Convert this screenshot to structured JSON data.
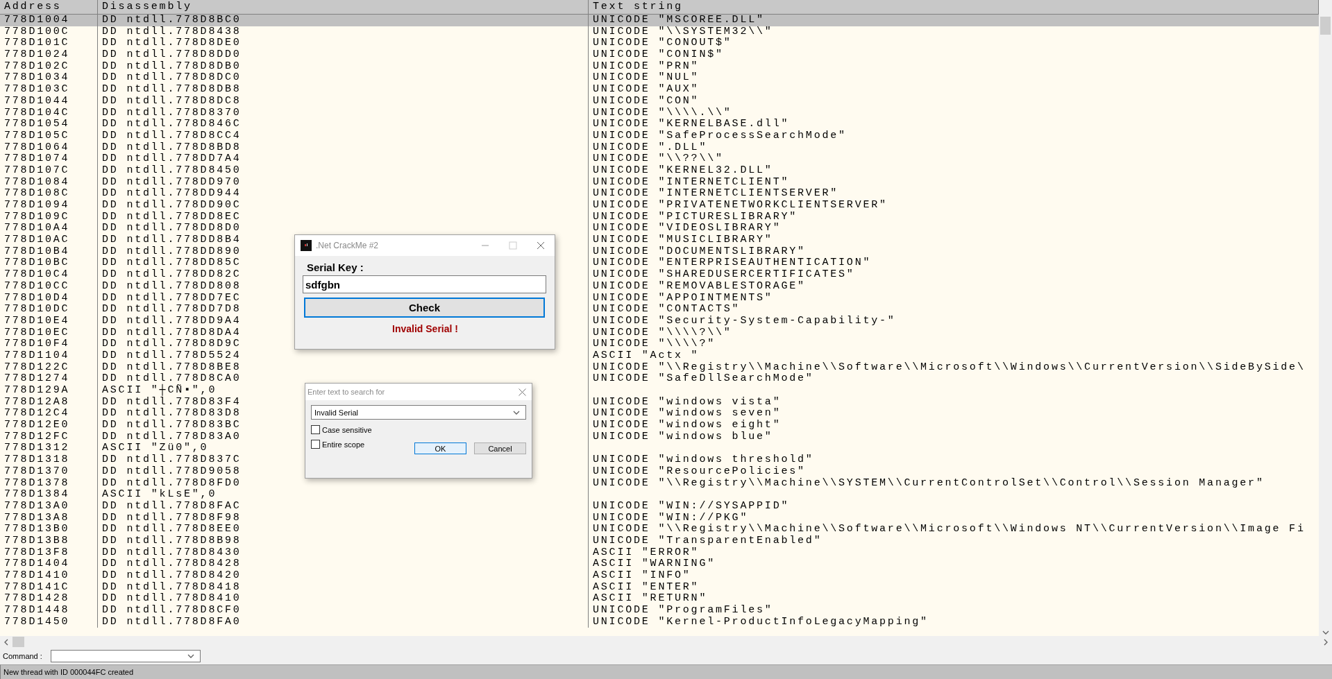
{
  "table": {
    "columns": [
      "Address",
      "Disassembly",
      "Text string"
    ],
    "rows": [
      {
        "address": "778D1004",
        "disassembly": "DD ntdll.778D8BC0",
        "text": "UNICODE \"MSCOREE.DLL\"",
        "selected": true
      },
      {
        "address": "778D100C",
        "disassembly": "DD ntdll.778D8438",
        "text": "UNICODE \"\\\\SYSTEM32\\\\\"",
        "selected": false
      },
      {
        "address": "778D101C",
        "disassembly": "DD ntdll.778D8DE0",
        "text": "UNICODE \"CONOUT$\"",
        "selected": false
      },
      {
        "address": "778D1024",
        "disassembly": "DD ntdll.778D8DD0",
        "text": "UNICODE \"CONIN$\"",
        "selected": false
      },
      {
        "address": "778D102C",
        "disassembly": "DD ntdll.778D8DB0",
        "text": "UNICODE \"PRN\"",
        "selected": false
      },
      {
        "address": "778D1034",
        "disassembly": "DD ntdll.778D8DC0",
        "text": "UNICODE \"NUL\"",
        "selected": false
      },
      {
        "address": "778D103C",
        "disassembly": "DD ntdll.778D8DB8",
        "text": "UNICODE \"AUX\"",
        "selected": false
      },
      {
        "address": "778D1044",
        "disassembly": "DD ntdll.778D8DC8",
        "text": "UNICODE \"CON\"",
        "selected": false
      },
      {
        "address": "778D104C",
        "disassembly": "DD ntdll.778D8370",
        "text": "UNICODE \"\\\\\\\\.\\\\\"",
        "selected": false
      },
      {
        "address": "778D1054",
        "disassembly": "DD ntdll.778D846C",
        "text": "UNICODE \"KERNELBASE.dll\"",
        "selected": false
      },
      {
        "address": "778D105C",
        "disassembly": "DD ntdll.778D8CC4",
        "text": "UNICODE \"SafeProcessSearchMode\"",
        "selected": false
      },
      {
        "address": "778D1064",
        "disassembly": "DD ntdll.778D8BD8",
        "text": "UNICODE \".DLL\"",
        "selected": false
      },
      {
        "address": "778D1074",
        "disassembly": "DD ntdll.778DD7A4",
        "text": "UNICODE \"\\\\??\\\\\"",
        "selected": false
      },
      {
        "address": "778D107C",
        "disassembly": "DD ntdll.778D8450",
        "text": "UNICODE \"KERNEL32.DLL\"",
        "selected": false
      },
      {
        "address": "778D1084",
        "disassembly": "DD ntdll.778DD970",
        "text": "UNICODE \"INTERNETCLIENT\"",
        "selected": false
      },
      {
        "address": "778D108C",
        "disassembly": "DD ntdll.778DD944",
        "text": "UNICODE \"INTERNETCLIENTSERVER\"",
        "selected": false
      },
      {
        "address": "778D1094",
        "disassembly": "DD ntdll.778DD90C",
        "text": "UNICODE \"PRIVATENETWORKCLIENTSERVER\"",
        "selected": false
      },
      {
        "address": "778D109C",
        "disassembly": "DD ntdll.778DD8EC",
        "text": "UNICODE \"PICTURESLIBRARY\"",
        "selected": false
      },
      {
        "address": "778D10A4",
        "disassembly": "DD ntdll.778DD8D0",
        "text": "UNICODE \"VIDEOSLIBRARY\"",
        "selected": false
      },
      {
        "address": "778D10AC",
        "disassembly": "DD ntdll.778DD8B4",
        "text": "UNICODE \"MUSICLIBRARY\"",
        "selected": false
      },
      {
        "address": "778D10B4",
        "disassembly": "DD ntdll.778DD890",
        "text": "UNICODE \"DOCUMENTSLIBRARY\"",
        "selected": false
      },
      {
        "address": "778D10BC",
        "disassembly": "DD ntdll.778DD85C",
        "text": "UNICODE \"ENTERPRISEAUTHENTICATION\"",
        "selected": false
      },
      {
        "address": "778D10C4",
        "disassembly": "DD ntdll.778DD82C",
        "text": "UNICODE \"SHAREDUSERCERTIFICATES\"",
        "selected": false
      },
      {
        "address": "778D10CC",
        "disassembly": "DD ntdll.778DD808",
        "text": "UNICODE \"REMOVABLESTORAGE\"",
        "selected": false
      },
      {
        "address": "778D10D4",
        "disassembly": "DD ntdll.778DD7EC",
        "text": "UNICODE \"APPOINTMENTS\"",
        "selected": false
      },
      {
        "address": "778D10DC",
        "disassembly": "DD ntdll.778DD7D8",
        "text": "UNICODE \"CONTACTS\"",
        "selected": false
      },
      {
        "address": "778D10E4",
        "disassembly": "DD ntdll.778DD9A4",
        "text": "UNICODE \"Security-System-Capability-\"",
        "selected": false
      },
      {
        "address": "778D10EC",
        "disassembly": "DD ntdll.778D8DA4",
        "text": "UNICODE \"\\\\\\\\?\\\\\"",
        "selected": false
      },
      {
        "address": "778D10F4",
        "disassembly": "DD ntdll.778D8D9C",
        "text": "UNICODE \"\\\\\\\\?\"",
        "selected": false
      },
      {
        "address": "778D1104",
        "disassembly": "DD ntdll.778D5524",
        "text": "ASCII \"Actx \"",
        "selected": false
      },
      {
        "address": "778D122C",
        "disassembly": "DD ntdll.778D8BE8",
        "text": "UNICODE \"\\\\Registry\\\\Machine\\\\Software\\\\Microsoft\\\\Windows\\\\CurrentVersion\\\\SideBySide\\",
        "selected": false
      },
      {
        "address": "778D1274",
        "disassembly": "DD ntdll.778D8CA0",
        "text": "UNICODE \"SafeDllSearchMode\"",
        "selected": false
      },
      {
        "address": "778D129A",
        "disassembly": "ASCII \"┼CÑ▪\",0",
        "selected": false
      },
      {
        "address": "778D12A8",
        "disassembly": "DD ntdll.778D83F4",
        "text": "UNICODE \"windows vista\"",
        "selected": false
      },
      {
        "address": "778D12C4",
        "disassembly": "DD ntdll.778D83D8",
        "text": "UNICODE \"windows seven\"",
        "selected": false
      },
      {
        "address": "778D12E0",
        "disassembly": "DD ntdll.778D83BC",
        "text": "UNICODE \"windows eight\"",
        "selected": false
      },
      {
        "address": "778D12FC",
        "disassembly": "DD ntdll.778D83A0",
        "text": "UNICODE \"windows blue\"",
        "selected": false
      },
      {
        "address": "778D1312",
        "disassembly": "ASCII \"Zü0\",0",
        "selected": false
      },
      {
        "address": "778D1318",
        "disassembly": "DD ntdll.778D837C",
        "text": "UNICODE \"windows threshold\"",
        "selected": false
      },
      {
        "address": "778D1370",
        "disassembly": "DD ntdll.778D9058",
        "text": "UNICODE \"ResourcePolicies\"",
        "selected": false
      },
      {
        "address": "778D1378",
        "disassembly": "DD ntdll.778D8FD0",
        "text": "UNICODE \"\\\\Registry\\\\Machine\\\\SYSTEM\\\\CurrentControlSet\\\\Control\\\\Session Manager\"",
        "selected": false
      },
      {
        "address": "778D1384",
        "disassembly": "ASCII \"kLsE\",0",
        "selected": false
      },
      {
        "address": "778D13A0",
        "disassembly": "DD ntdll.778D8FAC",
        "text": "UNICODE \"WIN://SYSAPPID\"",
        "selected": false
      },
      {
        "address": "778D13A8",
        "disassembly": "DD ntdll.778D8F98",
        "text": "UNICODE \"WIN://PKG\"",
        "selected": false
      },
      {
        "address": "778D13B0",
        "disassembly": "DD ntdll.778D8EE0",
        "text": "UNICODE \"\\\\Registry\\\\Machine\\\\Software\\\\Microsoft\\\\Windows NT\\\\CurrentVersion\\\\Image Fi",
        "selected": false
      },
      {
        "address": "778D13B8",
        "disassembly": "DD ntdll.778D8B98",
        "text": "UNICODE \"TransparentEnabled\"",
        "selected": false
      },
      {
        "address": "778D13F8",
        "disassembly": "DD ntdll.778D8430",
        "text": "ASCII \"ERROR\"",
        "selected": false
      },
      {
        "address": "778D1404",
        "disassembly": "DD ntdll.778D8428",
        "text": "ASCII \"WARNING\"",
        "selected": false
      },
      {
        "address": "778D1410",
        "disassembly": "DD ntdll.778D8420",
        "text": "ASCII \"INFO\"",
        "selected": false
      },
      {
        "address": "778D141C",
        "disassembly": "DD ntdll.778D8418",
        "text": "ASCII \"ENTER\"",
        "selected": false
      },
      {
        "address": "778D1428",
        "disassembly": "DD ntdll.778D8410",
        "text": "ASCII \"RETURN\"",
        "selected": false
      },
      {
        "address": "778D1448",
        "disassembly": "DD ntdll.778D8CF0",
        "text": "UNICODE \"ProgramFiles\"",
        "selected": false
      },
      {
        "address": "778D1450",
        "disassembly": "DD ntdll.778D8FA0",
        "text": "UNICODE \"Kernel-ProductInfoLegacyMapping\"",
        "selected": false
      }
    ]
  },
  "crackme_window": {
    "title": ".Net CrackMe #2",
    "label": "Serial Key :",
    "serial": {
      "value": "sdfgbn"
    },
    "button": "Check",
    "message": "Invalid Serial !"
  },
  "search_dialog": {
    "title": "Enter text to search for",
    "query": {
      "value": "Invalid Serial"
    },
    "options": [
      {
        "label": "Case sensitive",
        "checked": false
      },
      {
        "label": "Entire scope",
        "checked": false
      }
    ],
    "buttons": [
      "OK",
      "Cancel"
    ]
  },
  "command_bar": {
    "label": "Command :"
  },
  "status_bar": "New thread with ID 000044FC created"
}
